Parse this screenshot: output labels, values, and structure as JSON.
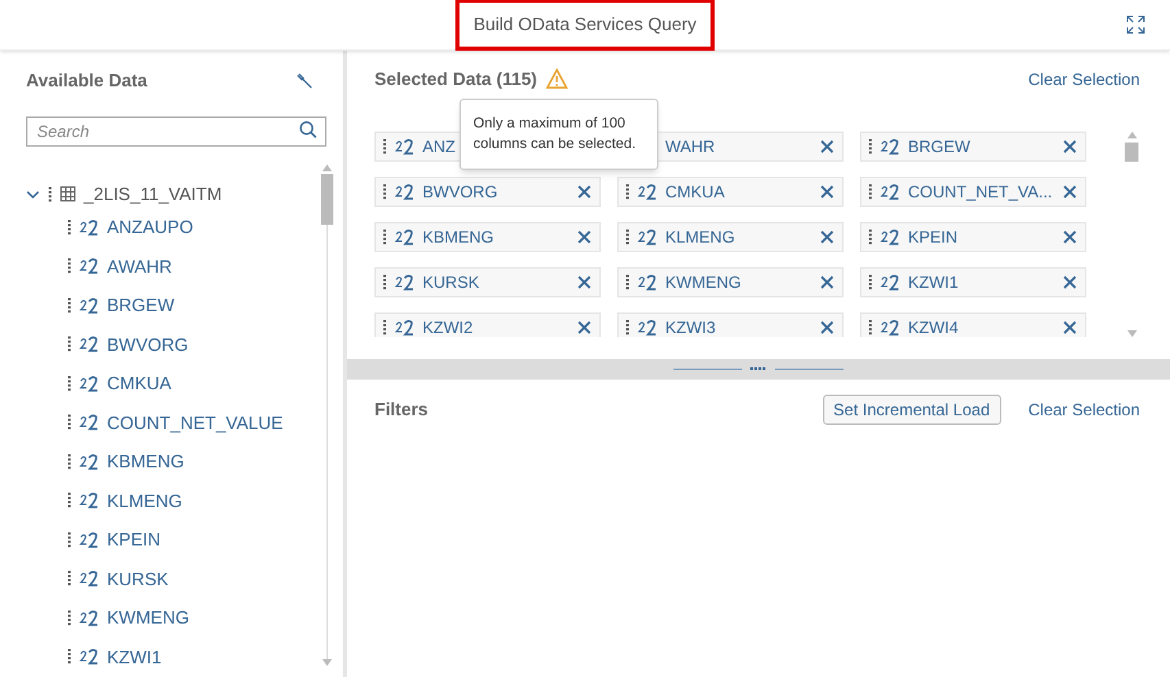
{
  "window": {
    "title": "Build OData Services Query",
    "highlighted": true
  },
  "available": {
    "title": "Available Data",
    "search": {
      "placeholder": "Search"
    },
    "tree": [
      {
        "label": "_2LIS_11_VAITM",
        "expanded": true,
        "children": [
          {
            "label": "ANZAUPO"
          },
          {
            "label": "AWAHR"
          },
          {
            "label": "BRGEW"
          },
          {
            "label": "BWVORG"
          },
          {
            "label": "CMKUA"
          },
          {
            "label": "COUNT_NET_VALUE"
          },
          {
            "label": "KBMENG"
          },
          {
            "label": "KLMENG"
          },
          {
            "label": "KPEIN"
          },
          {
            "label": "KURSK"
          },
          {
            "label": "KWMENG"
          },
          {
            "label": "KZWI1"
          }
        ]
      }
    ]
  },
  "selected": {
    "title": "Selected Data (115)",
    "clear": "Clear Selection",
    "tooltip": "Only a maximum of 100 columns can be selected.",
    "tokens": [
      {
        "label": "ANZ",
        "close": false
      },
      {
        "label": "WAHR",
        "handle": false
      },
      {
        "label": "BRGEW"
      },
      {
        "label": "BWVORG"
      },
      {
        "label": "CMKUA"
      },
      {
        "label": "COUNT_NET_VA..."
      },
      {
        "label": "KBMENG"
      },
      {
        "label": "KLMENG"
      },
      {
        "label": "KPEIN"
      },
      {
        "label": "KURSK"
      },
      {
        "label": "KWMENG"
      },
      {
        "label": "KZWI1"
      },
      {
        "label": "KZWI2"
      },
      {
        "label": "KZWI3"
      },
      {
        "label": "KZWI4"
      }
    ]
  },
  "filters": {
    "title": "Filters",
    "incremental": "Set Incremental Load",
    "clear": "Clear Selection"
  }
}
